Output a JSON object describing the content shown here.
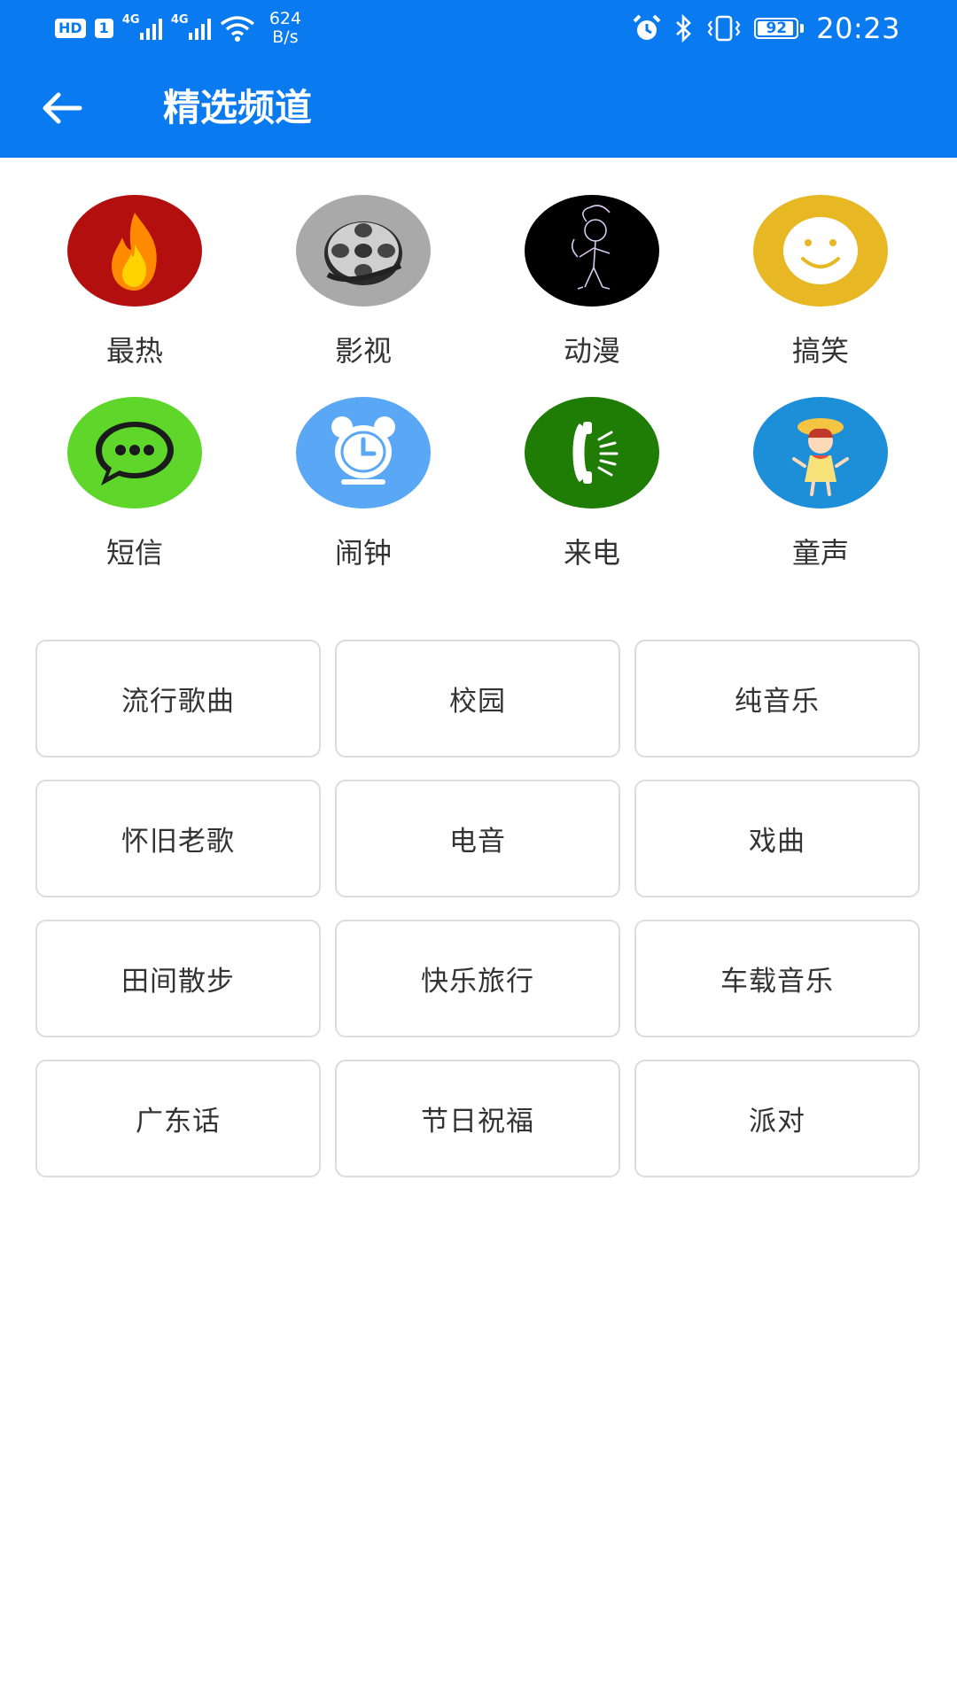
{
  "status_bar": {
    "hd": "HD",
    "sim": "1",
    "net1": "4G",
    "net2": "4G",
    "speed_value": "624",
    "speed_unit": "B/s",
    "battery": "92",
    "time": "20:23"
  },
  "app_bar": {
    "title": "精选频道"
  },
  "channels": [
    {
      "label": "最热",
      "icon": "fire-icon",
      "color": "#b30f0f"
    },
    {
      "label": "影视",
      "icon": "film-reel-icon",
      "color": "#a9a9a9"
    },
    {
      "label": "动漫",
      "icon": "anime-sketch-icon",
      "color": "#000000"
    },
    {
      "label": "搞笑",
      "icon": "smiley-icon",
      "color": "#e7b724"
    },
    {
      "label": "短信",
      "icon": "chat-bubble-icon",
      "color": "#5fd62a"
    },
    {
      "label": "闹钟",
      "icon": "alarm-clock-icon",
      "color": "#5aa8f5"
    },
    {
      "label": "来电",
      "icon": "phone-ringing-icon",
      "color": "#1f7d05"
    },
    {
      "label": "童声",
      "icon": "child-girl-icon",
      "color": "#1c8fd8"
    }
  ],
  "categories": [
    "流行歌曲",
    "校园",
    "纯音乐",
    "怀旧老歌",
    "电音",
    "戏曲",
    "田间散步",
    "快乐旅行",
    "车载音乐",
    "广东话",
    "节日祝福",
    "派对"
  ]
}
